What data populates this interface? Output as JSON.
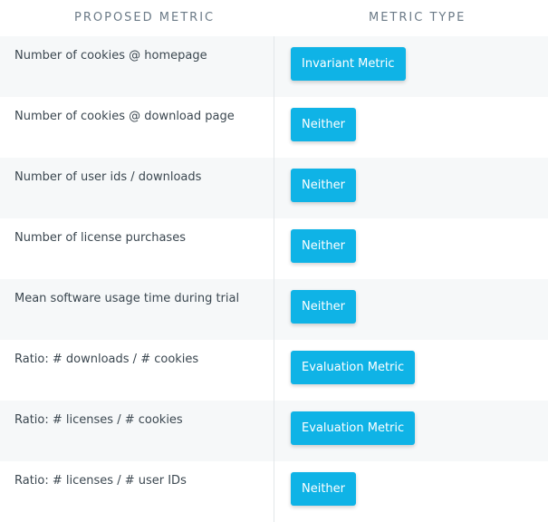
{
  "table": {
    "headers": {
      "proposed_metric": "PROPOSED METRIC",
      "metric_type": "METRIC TYPE"
    },
    "rows": [
      {
        "metric": "Number of cookies @ homepage",
        "type": "Invariant Metric"
      },
      {
        "metric": "Number of cookies @ download page",
        "type": "Neither"
      },
      {
        "metric": "Number of user ids / downloads",
        "type": "Neither"
      },
      {
        "metric": "Number of license purchases",
        "type": "Neither"
      },
      {
        "metric": "Mean software usage time during trial",
        "type": "Neither"
      },
      {
        "metric": "Ratio: # downloads / # cookies",
        "type": "Evaluation Metric"
      },
      {
        "metric": "Ratio: # licenses / # cookies",
        "type": "Evaluation Metric"
      },
      {
        "metric": "Ratio: # licenses / # user IDs",
        "type": "Neither"
      }
    ]
  },
  "colors": {
    "badge": "#0fb3e6",
    "row_shade": "#f6f8f9",
    "header_text": "#6b7a87",
    "body_text": "#3b4750"
  }
}
